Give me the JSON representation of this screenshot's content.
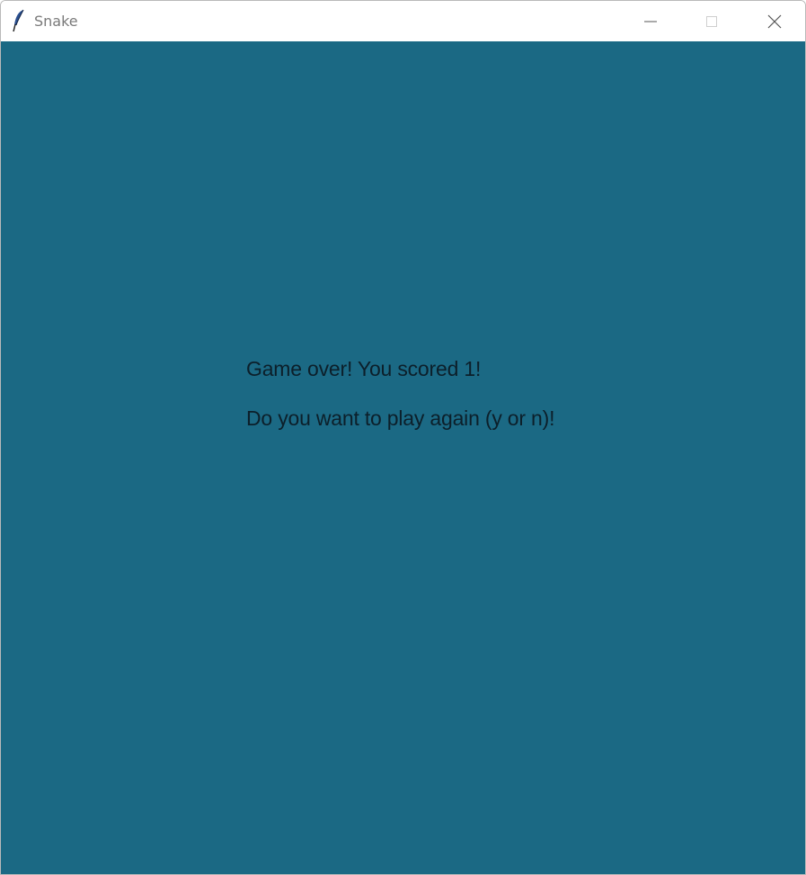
{
  "window": {
    "title": "Snake",
    "icon": "feather-icon",
    "controls": [
      "minimize-icon",
      "maximize-icon",
      "close-icon"
    ]
  },
  "game": {
    "background_color": "#1b6984",
    "text_color": "#0c1f2a",
    "message_line_1": "Game over! You scored 1!",
    "message_line_2": "Do you want to play again (y or n)!"
  }
}
